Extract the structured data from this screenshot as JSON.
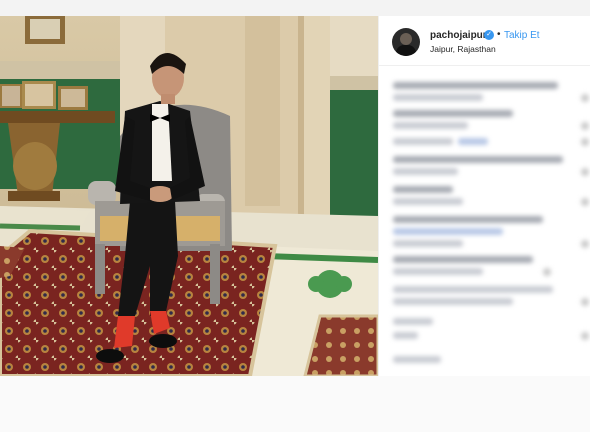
{
  "post": {
    "username": "pachojaipur",
    "verified_icon": "verified-badge-icon",
    "separator": "•",
    "follow_label": "Takip Et",
    "location": "Jaipur, Rajasthan"
  },
  "colors": {
    "accent": "#3897f0",
    "text": "#262626",
    "border": "#efefef"
  }
}
